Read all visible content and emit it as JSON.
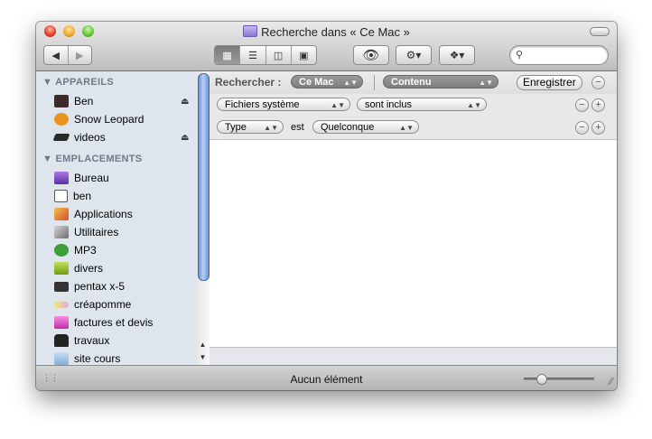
{
  "window": {
    "title": "Recherche dans « Ce Mac »",
    "status_text": "Aucun élément",
    "icon_size_slider": 0.2
  },
  "toolbar": {
    "nav": {
      "back_icon": "back-arrow-icon",
      "forward_icon": "forward-arrow-icon"
    },
    "views": [
      "icon-view-icon",
      "list-view-icon",
      "column-view-icon",
      "coverflow-view-icon"
    ],
    "active_view_index": 0,
    "search": {
      "value": "",
      "placeholder": ""
    }
  },
  "sidebar": {
    "devices_header": "APPAREILS",
    "devices": [
      {
        "label": "Ben",
        "icon": "user-disk-icon",
        "eject": true,
        "color": "#3c2a2a"
      },
      {
        "label": "Snow Leopard",
        "icon": "snow-leopard-disk-icon",
        "eject": false,
        "color": "#e8941c"
      },
      {
        "label": "videos",
        "icon": "disk-icon",
        "eject": true,
        "color": "#2a2a2a"
      }
    ],
    "places_header": "EMPLACEMENTS",
    "places": [
      {
        "label": "Bureau",
        "icon": "desktop-icon",
        "color": "#7b4dbf"
      },
      {
        "label": "ben",
        "icon": "home-icon",
        "color": "#c9a36a"
      },
      {
        "label": "Applications",
        "icon": "applications-icon",
        "color": "#d84b2a"
      },
      {
        "label": "Utilitaires",
        "icon": "utilities-icon",
        "color": "#8a8a8a"
      },
      {
        "label": "MP3",
        "icon": "mp3-icon",
        "color": "#3f9d3b"
      },
      {
        "label": "divers",
        "icon": "divers-folder-icon",
        "color": "#8fbf1f"
      },
      {
        "label": "pentax x-5",
        "icon": "camera-icon",
        "color": "#333333"
      },
      {
        "label": "créapomme",
        "icon": "creapomme-icon",
        "color": "#f0d23c"
      },
      {
        "label": "factures et devis",
        "icon": "factures-icon",
        "color": "#e04bc4"
      },
      {
        "label": "travaux",
        "icon": "travaux-icon",
        "color": "#222222"
      },
      {
        "label": "site cours",
        "icon": "folder-icon",
        "color": "#9dc2ea"
      }
    ]
  },
  "search_bar": {
    "label": "Rechercher :",
    "scope": "Ce Mac",
    "mode": "Contenu",
    "save_label": "Enregistrer"
  },
  "criteria": [
    {
      "attribute": "Fichiers système",
      "operator": "sont inclus"
    },
    {
      "attribute": "Type",
      "verb": "est",
      "value": "Quelconque"
    }
  ]
}
